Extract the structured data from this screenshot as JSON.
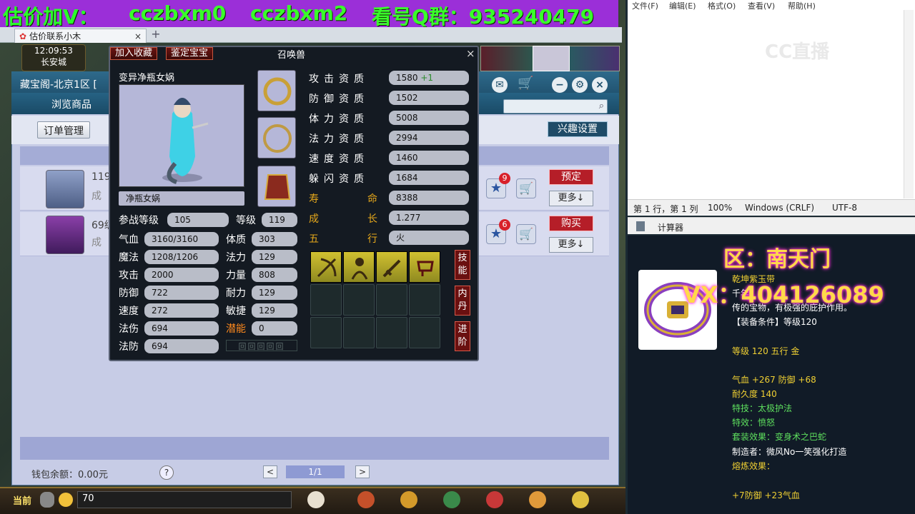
{
  "banner": {
    "text1": "估价加V：",
    "text2": "cczbxm0",
    "text3": "cczbxm2",
    "text4": "看号Q群：935240479"
  },
  "browser": {
    "tab_title": "估价联系小木",
    "close": "×",
    "new_tab": "+"
  },
  "game": {
    "time": "12:09:53",
    "location": "长安城",
    "current": "当前",
    "chat_value": "70"
  },
  "mall": {
    "title": "藏宝阁-北京1区 [",
    "nav_browse": "浏览商品",
    "order_manage": "订单管理",
    "interest": "兴趣设置",
    "rows": [
      {
        "text": "119",
        "sub": "成",
        "badge": "9",
        "action": "预定",
        "more": "更多↓"
      },
      {
        "text": "69级",
        "sub": "成",
        "badge": "6",
        "action": "购买",
        "more": "更多↓"
      }
    ],
    "wallet": "钱包余额：0.00元",
    "help": "?",
    "page": "1/1",
    "prev": "<",
    "next": ">"
  },
  "pet": {
    "tag_fav": "加入收藏",
    "tag_identify": "鉴定宝宝",
    "title": "召唤兽",
    "close": "×",
    "name": "变异净瓶女娲",
    "portrait_label": "净瓶女娲",
    "battle_level_label": "参战等级",
    "battle_level": "105",
    "level_label": "等级",
    "level": "119",
    "stats_left": [
      {
        "label": "气血",
        "value": "3160/3160"
      },
      {
        "label": "魔法",
        "value": "1208/1206"
      },
      {
        "label": "攻击",
        "value": "2000"
      },
      {
        "label": "防御",
        "value": "722"
      },
      {
        "label": "速度",
        "value": "272"
      },
      {
        "label": "法伤",
        "value": "694"
      },
      {
        "label": "法防",
        "value": "694"
      }
    ],
    "stats_mid": [
      {
        "label": "体质",
        "value": "303"
      },
      {
        "label": "法力",
        "value": "129"
      },
      {
        "label": "力量",
        "value": "808"
      },
      {
        "label": "耐力",
        "value": "129"
      },
      {
        "label": "敏捷",
        "value": "129"
      },
      {
        "label": "潜能",
        "value": "0"
      }
    ],
    "aptitudes": [
      {
        "label": "攻击资质",
        "value": "1580",
        "bonus": "+1"
      },
      {
        "label": "防御资质",
        "value": "1502"
      },
      {
        "label": "体力资质",
        "value": "5008"
      },
      {
        "label": "法力资质",
        "value": "2994"
      },
      {
        "label": "速度资质",
        "value": "1460"
      },
      {
        "label": "躲闪资质",
        "value": "1684"
      }
    ],
    "life_label1": "寿",
    "life_label2": "命",
    "life": "8388",
    "growth_label1": "成",
    "growth_label2": "长",
    "growth": "1.277",
    "element_label1": "五",
    "element_label2": "行",
    "element": "火",
    "side_skill": "技能",
    "side_inner": "内丹",
    "side_advance": "进阶"
  },
  "notepad": {
    "menu": [
      "文件(F)",
      "编辑(E)",
      "格式(O)",
      "查看(V)",
      "帮助(H)"
    ],
    "status": [
      "第 1 行，第 1 列",
      "100%",
      "Windows (CRLF)",
      "UTF-8"
    ],
    "watermark": "CC直播"
  },
  "calculator": {
    "title": "计算器"
  },
  "item": {
    "name": "乾坤紫玉带",
    "desc1": "千年",
    "desc2": "传的宝物，有极强的庇护作用。",
    "req": "【装备条件】等级120",
    "level": "等级 120 五行 金",
    "attr": "气血 +267 防御 +68",
    "durability": "耐久度 140",
    "special_skill": "特技：太极护法",
    "special_effect": "特效：愤怒",
    "set_effect": "套装效果：变身术之巴蛇",
    "maker": "制造者：微风No一笑强化打造",
    "forge": "熔炼效果：",
    "forge_value": "+7防御 +23气血",
    "region": "区：南天门",
    "vx": "VX：404126089"
  }
}
